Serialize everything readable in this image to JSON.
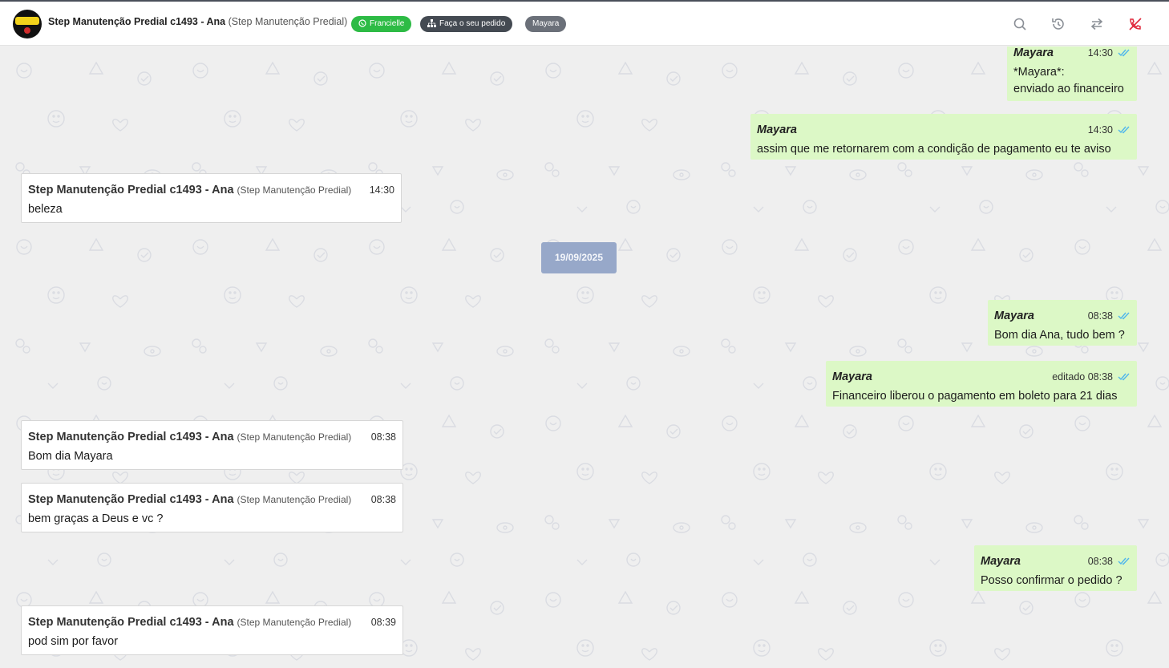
{
  "header": {
    "contact_name": "Step Manutenção Predial c1493 - Ana",
    "contact_org": "(Step Manutenção Predial)",
    "tags": {
      "whatsapp_user": "Francielle",
      "order": "Faça o seu pedido",
      "agent": "Mayara"
    },
    "icons": [
      "search-icon",
      "history-icon",
      "transfer-icon",
      "end-call-icon"
    ]
  },
  "colors": {
    "incoming_bubble": "#ffffff",
    "outgoing_bubble": "#dcf8c6",
    "date_pill": "#97a8c9",
    "read_check": "#4fb6ec",
    "tag_green": "#2dbb45",
    "tag_dark": "#444a52",
    "tag_gray": "#6b7079",
    "end_call": "#e0283b"
  },
  "messages": [
    {
      "dir": "out",
      "name": "Mayara",
      "time": "14:30",
      "lines": [
        "*Mayara*:",
        "enviado ao financeiro"
      ]
    },
    {
      "dir": "out",
      "name": "Mayara",
      "time": "14:30",
      "text": "assim que me retornarem com a condição de pagamento eu te aviso"
    },
    {
      "dir": "in",
      "name": "Step Manutenção Predial c1493 - Ana",
      "org": "(Step Manutenção Predial)",
      "time": "14:30",
      "text": "beleza"
    },
    {
      "dir": "out",
      "name": "Mayara",
      "time": "08:38",
      "text": "Bom dia Ana, tudo bem ?"
    },
    {
      "dir": "out",
      "name": "Mayara",
      "edited": "editado",
      "time": "08:38",
      "text": "Financeiro liberou o pagamento em boleto para 21 dias"
    },
    {
      "dir": "in",
      "name": "Step Manutenção Predial c1493 - Ana",
      "org": "(Step Manutenção Predial)",
      "time": "08:38",
      "text": "Bom dia Mayara"
    },
    {
      "dir": "in",
      "name": "Step Manutenção Predial c1493 - Ana",
      "org": "(Step Manutenção Predial)",
      "time": "08:38",
      "text": "bem graças a Deus e vc ?"
    },
    {
      "dir": "out",
      "name": "Mayara",
      "time": "08:38",
      "text": "Posso confirmar o pedido ?"
    },
    {
      "dir": "in",
      "name": "Step Manutenção Predial c1493 - Ana",
      "org": "(Step Manutenção Predial)",
      "time": "08:39",
      "text": "pod sim por favor"
    }
  ],
  "date_separator": "19/09/2025"
}
